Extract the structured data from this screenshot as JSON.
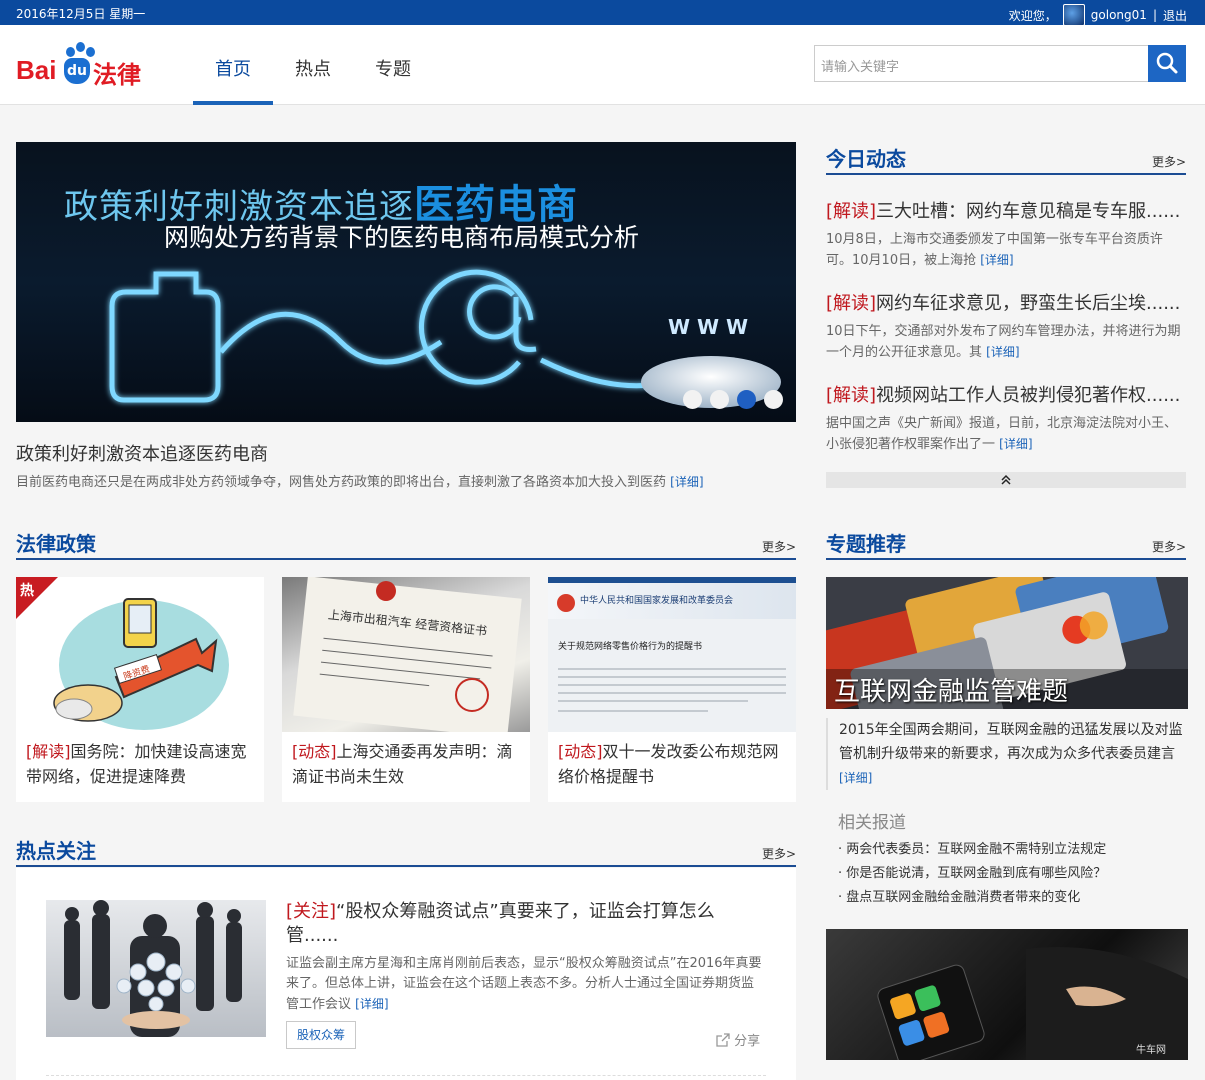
{
  "topbar": {
    "date": "2016年12月5日 星期一",
    "welcome": "欢迎您，",
    "username": "golong01",
    "separator": "|",
    "logout": "退出"
  },
  "logo": {
    "bai": "Bai",
    "du": "du",
    "law": "法律"
  },
  "nav": {
    "tabs": [
      {
        "label": "首页"
      },
      {
        "label": "热点"
      },
      {
        "label": "专题"
      }
    ]
  },
  "search": {
    "placeholder": "请输入关键字"
  },
  "banner": {
    "headline_prefix": "政策利好刺激资本追逐",
    "headline_strong": "医药电商",
    "subheadline": "网购处方药背景下的医药电商布局模式分析",
    "www_text": "W W W"
  },
  "lead": {
    "title": "政策利好刺激资本追逐医药电商",
    "desc": "目前医药电商还只是在两成非处方药领域争夺，网售处方药政策的即将出台，直接刺激了各路资本加大投入到医药",
    "detail": "[详细]"
  },
  "today": {
    "title": "今日动态",
    "more": "更多>",
    "items": [
      {
        "tag": "[解读]",
        "title": "三大吐槽：网约车意见稿是专车服......",
        "desc": "10月8日，上海市交通委颁发了中国第一张专车平台资质许可。10月10日，被上海抢",
        "detail": "[详细]"
      },
      {
        "tag": "[解读]",
        "title": "网约车征求意见，野蛮生长后尘埃......",
        "desc": "10日下午，交通部对外发布了网约车管理办法，并将进行为期一个月的公开征求意见。其",
        "detail": "[详细]"
      },
      {
        "tag": "[解读]",
        "title": "视频网站工作人员被判侵犯著作权......",
        "desc": "据中国之声《央广新闻》报道，日前，北京海淀法院对小王、小张侵犯著作权罪案作出了一",
        "detail": "[详细]"
      }
    ],
    "collapse_icon": "double-chevron-up-icon"
  },
  "law_policy": {
    "title": "法律政策",
    "more": "更多>",
    "hot_badge": "热",
    "cards": [
      {
        "tag": "[解读]",
        "title": "国务院：加快建设高速宽带网络，促进提速降费",
        "img_text": "降资费"
      },
      {
        "tag": "[动态]",
        "title": "上海交通委再发声明：滴滴证书尚未生效",
        "img_text": "上海市出租汽车 经营资格证书"
      },
      {
        "tag": "[动态]",
        "title": "双十一发改委公布规范网络价格提醒书",
        "img_text": "中华人民共和国国家发展和改革委员会",
        "img_text2": "关于规范网络零售价格行为的提醒书"
      }
    ]
  },
  "hot_focus": {
    "title": "热点关注",
    "more": "更多>",
    "item": {
      "tag": "[关注]",
      "title": "“股权众筹融资试点”真要来了，证监会打算怎么管......",
      "desc": "证监会副主席方星海和主席肖刚前后表态，显示“股权众筹融资试点”在2016年真要来了。但总体上讲，证监会在这个话题上表态不多。分析人士通过全国证券期货监管工作会议",
      "detail": "[详细]",
      "chip": "股权众筹",
      "share": "分享"
    }
  },
  "topics": {
    "title": "专题推荐",
    "more": "更多>",
    "img_caption": "互联网金融监管难题",
    "text": "2015年全国两会期间，互联网金融的迅猛发展以及对监管机制升级带来的新要求，再次成为众多代表委员建言",
    "detail": "[详细]",
    "related_title": "相关报道",
    "related": [
      "· 两会代表委员：互联网金融不需特别立法规定",
      "· 你是否能说清，互联网金融到底有哪些风险？",
      "· 盘点互联网金融给金融消费者带来的变化"
    ],
    "img2_watermark": "牛车网"
  },
  "colors": {
    "topbar": "#0b4a9e",
    "accent": "#1b63b8",
    "tag_red": "#c0181e"
  }
}
